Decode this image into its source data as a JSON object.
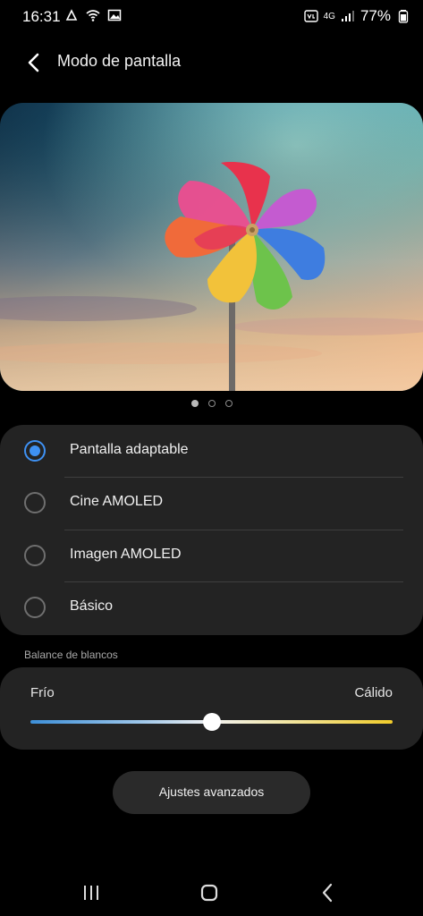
{
  "status_bar": {
    "time": "16:31",
    "battery": "77%",
    "network": "4G"
  },
  "header": {
    "title": "Modo de pantalla"
  },
  "preview": {
    "page_count": 3,
    "active_page": 1
  },
  "modes": [
    {
      "label": "Pantalla adaptable",
      "selected": true
    },
    {
      "label": "Cine AMOLED",
      "selected": false
    },
    {
      "label": "Imagen AMOLED",
      "selected": false
    },
    {
      "label": "Básico",
      "selected": false
    }
  ],
  "white_balance": {
    "title": "Balance de blancos",
    "cold_label": "Frío",
    "warm_label": "Cálido",
    "value": 0.5
  },
  "advanced_button": {
    "label": "Ajustes avanzados"
  },
  "colors": {
    "accent": "#3e91f3",
    "card": "#232323",
    "background": "#000000"
  },
  "nav_bar": {
    "icons": [
      "recents-icon",
      "home-icon",
      "back-icon"
    ]
  }
}
